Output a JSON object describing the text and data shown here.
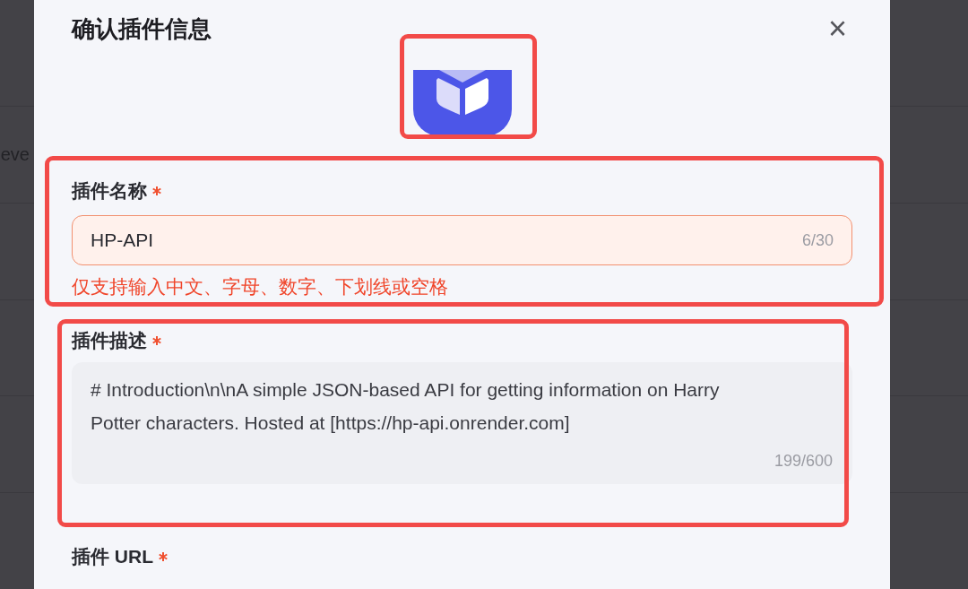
{
  "backdrop": {
    "row_text": "eve"
  },
  "dialog": {
    "title": "确认插件信息",
    "close": "×",
    "icon": {
      "highlighted": true
    },
    "fields": [
      {
        "kind": "input",
        "label": "插件名称",
        "required": true,
        "highlighted": true,
        "value": "HP-API",
        "counter": "6/30",
        "error": "仅支持输入中文、字母、数字、下划线或空格"
      },
      {
        "kind": "textarea",
        "label": "插件描述",
        "required": true,
        "highlighted": true,
        "value": "# Introduction\\n\\nA simple JSON-based API for getting information on Harry Potter characters. Hosted at [https://hp-api.onrender.com]",
        "counter": "199/600"
      },
      {
        "kind": "heading",
        "label": "插件 URL",
        "required": true
      }
    ]
  }
}
